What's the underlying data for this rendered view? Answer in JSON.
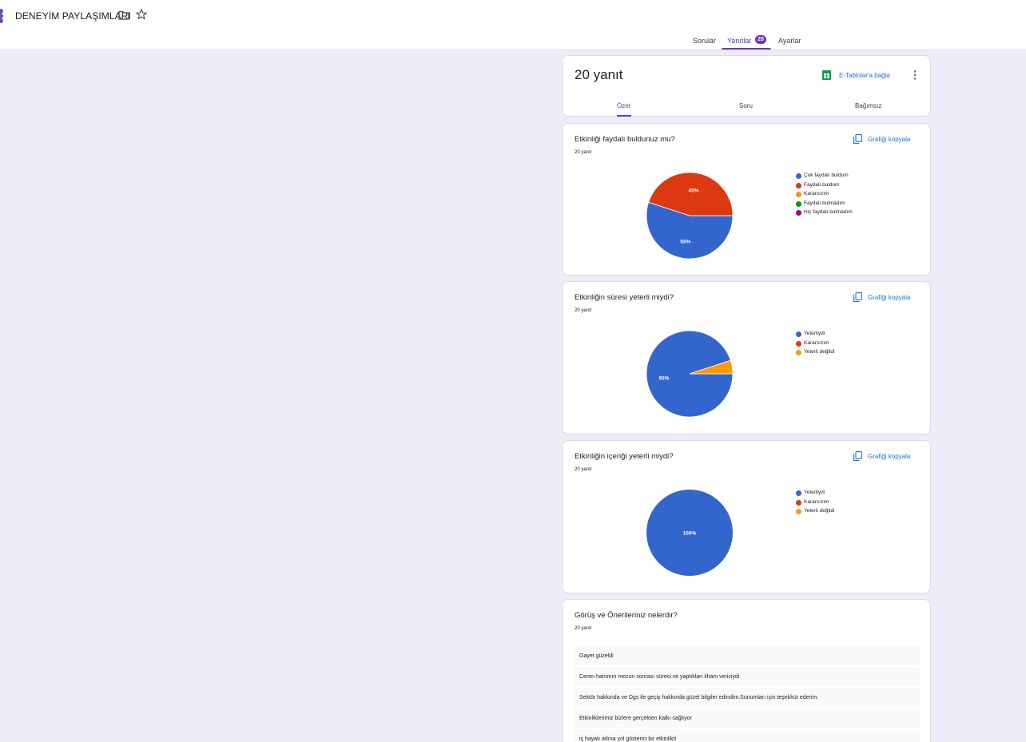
{
  "header": {
    "title": "DENEYİM PAYLAŞIMLARI",
    "tabs": [
      "Sorular",
      "Yanıtlar",
      "Ayarlar"
    ],
    "responses_badge": "20"
  },
  "summary": {
    "count_label": "20 yanıt",
    "sheets_link": "E-Tablolar'a bağla",
    "sub_tabs": [
      "Özet",
      "Soru",
      "Bağımsız"
    ]
  },
  "colors": {
    "accent": "#673ab7",
    "link": "#1a73e8",
    "sheets_green": "#0f9d58"
  },
  "copy_label": "Grafiği kopyala",
  "questions": [
    {
      "title": "Etkinliği faydalı buldunuz mu?",
      "count": "20 yanıt"
    },
    {
      "title": "Etkinliğin süresi yeterli miydi?",
      "count": "20 yanıt"
    },
    {
      "title": "Etkinliğin içeriği yeterli miydi?",
      "count": "20 yanıt"
    },
    {
      "title": "Görüş ve Önerileriniz nelerdir?",
      "count": "20 yanıt"
    }
  ],
  "chart_data": [
    {
      "type": "pie",
      "categories": [
        "Çok faydalı buldum",
        "Faydalı buldum",
        "Kararsızım",
        "Faydalı bulmadım",
        "Hiç faydalı bulmadım"
      ],
      "values": [
        55,
        45,
        0,
        0,
        0
      ],
      "colors": [
        "#3366cc",
        "#dc3912",
        "#ff9900",
        "#109618",
        "#990099"
      ],
      "labels": [
        "55%",
        "45%",
        "",
        "",
        ""
      ]
    },
    {
      "type": "pie",
      "categories": [
        "Yeterliydi",
        "Kararsızım",
        "Yeterli değildi"
      ],
      "values": [
        95,
        0,
        5
      ],
      "colors": [
        "#3366cc",
        "#dc3912",
        "#ff9900"
      ],
      "labels": [
        "95%",
        "",
        ""
      ]
    },
    {
      "type": "pie",
      "categories": [
        "Yeterliydi",
        "Kararsızım",
        "Yeterli değildi"
      ],
      "values": [
        100,
        0,
        0
      ],
      "colors": [
        "#3366cc",
        "#dc3912",
        "#ff9900"
      ],
      "labels": [
        "100%",
        "",
        ""
      ]
    }
  ],
  "text_answers": [
    "Gayet güzeldi",
    "Ceren hanımın mezun sonrası süreci ve yaptıkları ilham vericiydi",
    "Sektör hakkında ve Dgs ile geçiş hakkında güzel bilgiler edindim.Sunumları için teşekkür ederim.",
    "Etkinliklerimiz bizlere gerçekten katkı sağlıyor",
    "iş hayatı adına yol gösterici bir etkinlikti"
  ]
}
